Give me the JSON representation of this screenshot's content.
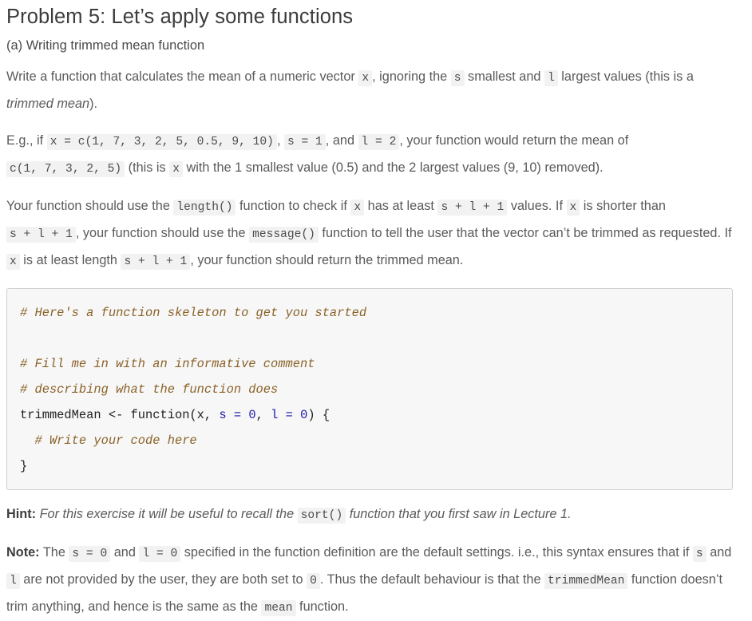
{
  "problem": {
    "title": "Problem 5: Let’s apply some functions",
    "part_label": "(a) Writing trimmed mean function"
  },
  "paragraphs": {
    "intro": {
      "t1": "Write a function that calculates the mean of a numeric vector ",
      "c1": "x",
      "t2": ", ignoring the ",
      "c2": "s",
      "t3": " smallest and ",
      "c3": "l",
      "t4": " largest values (this is a ",
      "em1": "trimmed mean",
      "t5": ")."
    },
    "example": {
      "t1": "E.g., if ",
      "c1": "x = c(1, 7, 3, 2, 5, 0.5, 9, 10)",
      "t2": ", ",
      "c2": "s = 1",
      "t3": ", and ",
      "c3": "l = 2",
      "t4": ", your function would return the mean of ",
      "c4": "c(1, 7, 3, 2, 5)",
      "t5": " (this is ",
      "c5": "x",
      "t6": " with the 1 smallest value (0.5) and the 2 largest values (9, 10) removed)."
    },
    "requirements": {
      "t1": "Your function should use the ",
      "c1": "length()",
      "t2": " function to check if ",
      "c2": "x",
      "t3": " has at least ",
      "c3": "s + l + 1",
      "t4": " values. If ",
      "c4": "x",
      "t5": " is shorter than ",
      "c5": "s + l + 1",
      "t6": ", your function should use the ",
      "c6": "message()",
      "t7": " function to tell the user that the vector can’t be trimmed as requested. If ",
      "c7": "x",
      "t8": " is at least length ",
      "c8": "s + l + 1",
      "t9": ", your function should return the trimmed mean."
    },
    "hint": {
      "label": "Hint:",
      "t1": " For this exercise it will be useful to recall the ",
      "c1": "sort()",
      "t2": " function that you first saw in Lecture 1."
    },
    "note": {
      "label": "Note:",
      "t1": " The ",
      "c1": "s = 0",
      "t2": " and ",
      "c2": "l = 0",
      "t3": " specified in the function definition are the default settings. i.e., this syntax ensures that if ",
      "c3": "s",
      "t4": " and ",
      "c4": "l",
      "t5": " are not provided by the user, they are both set to ",
      "c5": "0",
      "t6": ". Thus the default behaviour is that the ",
      "c6": "trimmedMean",
      "t7": " function doesn’t trim anything, and hence is the same as the ",
      "c7": "mean",
      "t8": " function."
    }
  },
  "code_block": {
    "line1_comment": "# Here's a function skeleton to get you started",
    "line2_blank": "",
    "line3_comment": "# Fill me in with an informative comment",
    "line4_comment": "# describing what the function does",
    "line5_a": "trimmedMean <- function(x, ",
    "line5_kw1": "s",
    "line5_b": " ",
    "line5_kw2": "=",
    "line5_c": " ",
    "line5_kw3": "0",
    "line5_d": ", ",
    "line5_kw4": "l",
    "line5_e": " ",
    "line5_kw5": "=",
    "line5_f": " ",
    "line5_kw6": "0",
    "line5_g": ") {",
    "line6_comment": "  # Write your code here",
    "line7": "}"
  },
  "colors": {
    "page_background": "#ffffff",
    "body_text": "#5a5a5a",
    "heading_text": "#3c3c3c",
    "inline_code_background": "#f2f2f2",
    "code_block_background": "#f7f7f7",
    "code_block_border": "#cfcfcf",
    "comment": "#8a6228",
    "keyword_blue": "#1a1aa6"
  }
}
